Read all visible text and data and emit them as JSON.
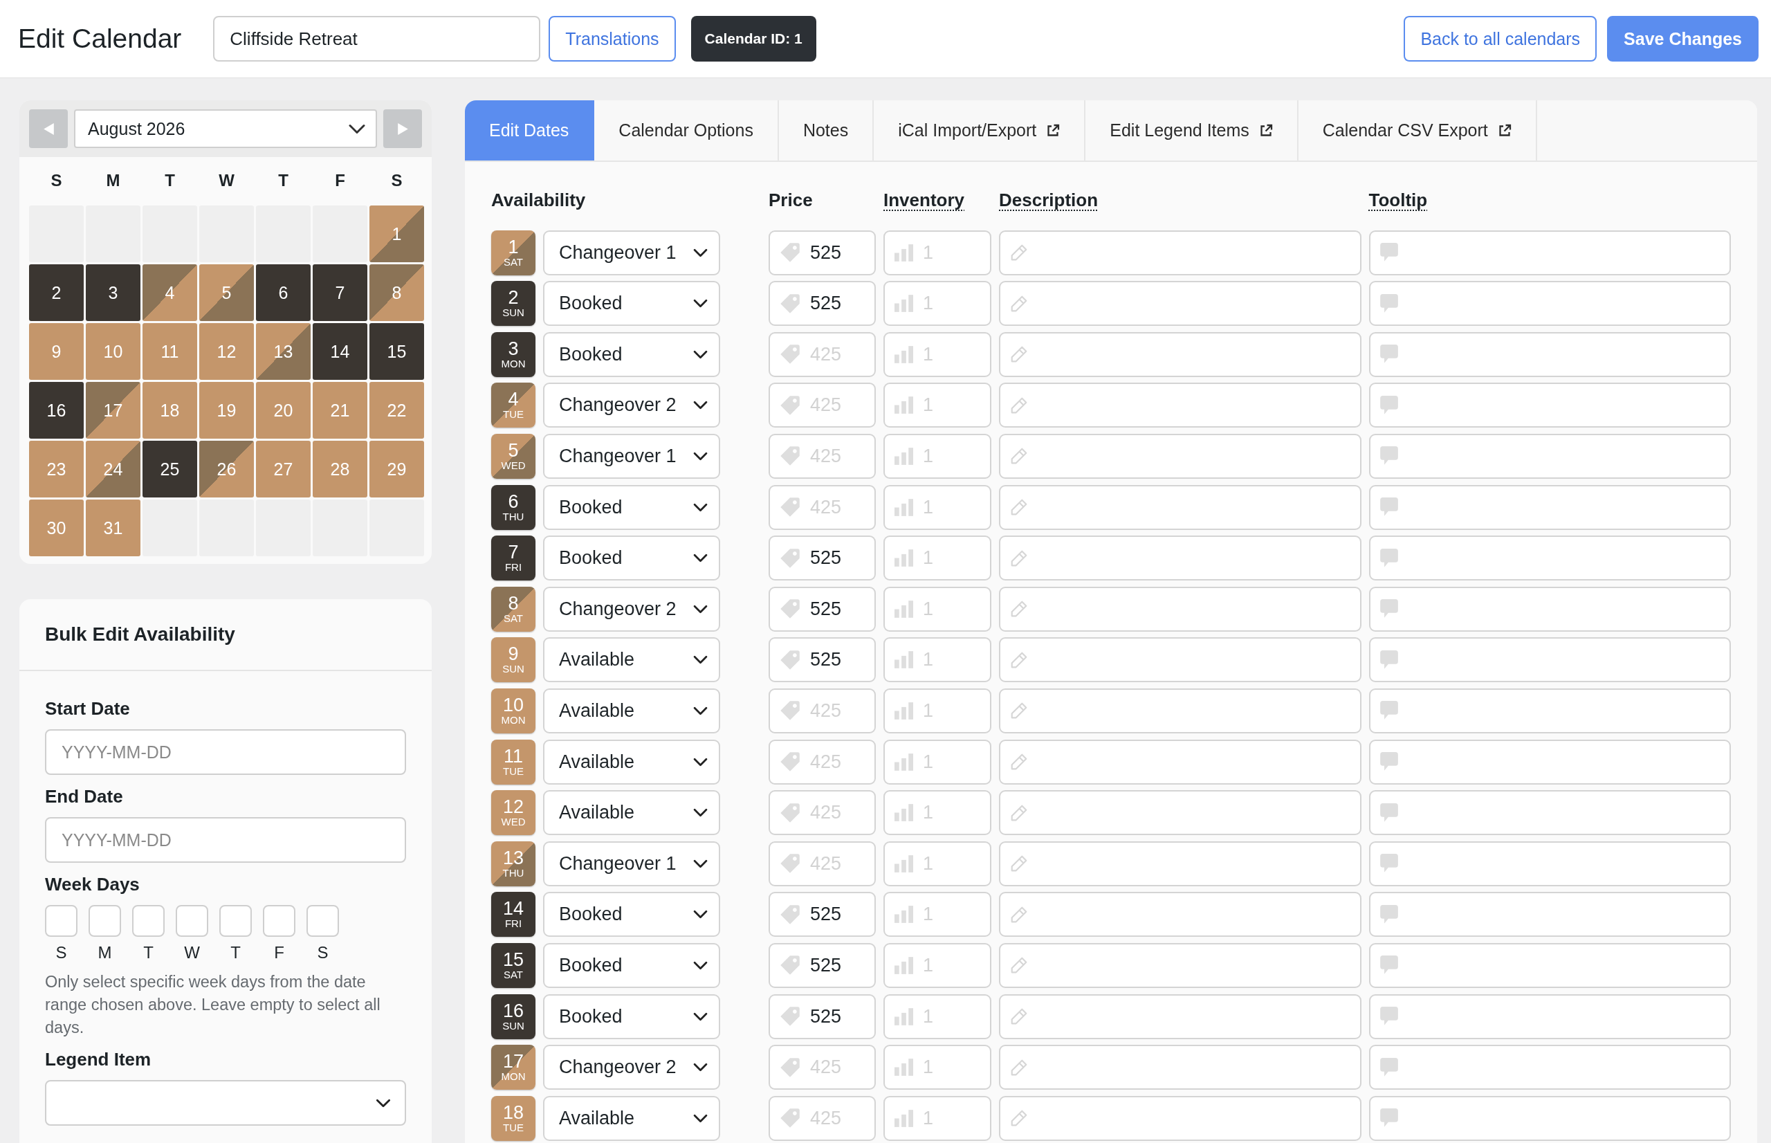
{
  "header": {
    "title": "Edit Calendar",
    "name_field": {
      "value": "Cliffside Retreat"
    },
    "left_buttons": [
      {
        "label": "Translations",
        "kind": "outline"
      },
      {
        "label": "Calendar ID: 1",
        "kind": "dark"
      }
    ],
    "right_buttons": [
      {
        "label": "Back to all calendars",
        "kind": "outline"
      },
      {
        "label": "Save Changes",
        "kind": "primary"
      }
    ]
  },
  "calendar": {
    "month": "August 2026",
    "weekdays": [
      "S",
      "M",
      "T",
      "W",
      "T",
      "F",
      "S"
    ],
    "weeks": [
      [
        {
          "kind": "empty"
        },
        {
          "kind": "empty"
        },
        {
          "kind": "empty"
        },
        {
          "kind": "empty"
        },
        {
          "kind": "empty"
        },
        {
          "kind": "empty"
        },
        {
          "day": "1",
          "kind": "changeover_1"
        }
      ],
      [
        {
          "day": "2",
          "kind": "booked"
        },
        {
          "day": "3",
          "kind": "booked"
        },
        {
          "day": "4",
          "kind": "changeover_2"
        },
        {
          "day": "5",
          "kind": "changeover_1"
        },
        {
          "day": "6",
          "kind": "booked"
        },
        {
          "day": "7",
          "kind": "booked"
        },
        {
          "day": "8",
          "kind": "changeover_2"
        }
      ],
      [
        {
          "day": "9",
          "kind": "available"
        },
        {
          "day": "10",
          "kind": "available"
        },
        {
          "day": "11",
          "kind": "available"
        },
        {
          "day": "12",
          "kind": "available"
        },
        {
          "day": "13",
          "kind": "changeover_1"
        },
        {
          "day": "14",
          "kind": "booked"
        },
        {
          "day": "15",
          "kind": "booked"
        }
      ],
      [
        {
          "day": "16",
          "kind": "booked"
        },
        {
          "day": "17",
          "kind": "changeover_2"
        },
        {
          "day": "18",
          "kind": "available"
        },
        {
          "day": "19",
          "kind": "available"
        },
        {
          "day": "20",
          "kind": "available"
        },
        {
          "day": "21",
          "kind": "available"
        },
        {
          "day": "22",
          "kind": "available"
        }
      ],
      [
        {
          "day": "23",
          "kind": "available"
        },
        {
          "day": "24",
          "kind": "changeover_1"
        },
        {
          "day": "25",
          "kind": "booked"
        },
        {
          "day": "26",
          "kind": "changeover_2"
        },
        {
          "day": "27",
          "kind": "available"
        },
        {
          "day": "28",
          "kind": "available"
        },
        {
          "day": "29",
          "kind": "available"
        }
      ],
      [
        {
          "day": "30",
          "kind": "available"
        },
        {
          "day": "31",
          "kind": "available"
        },
        {
          "kind": "empty"
        },
        {
          "kind": "empty"
        },
        {
          "kind": "empty"
        },
        {
          "kind": "empty"
        },
        {
          "kind": "empty"
        }
      ]
    ]
  },
  "bulk_edit": {
    "title": "Bulk Edit Availability",
    "start_date": {
      "label": "Start Date",
      "placeholder": "YYYY-MM-DD"
    },
    "end_date": {
      "label": "End Date",
      "placeholder": "YYYY-MM-DD"
    },
    "week_days": {
      "label": "Week Days",
      "days": [
        {
          "label": "S",
          "checked": false
        },
        {
          "label": "M",
          "checked": false
        },
        {
          "label": "T",
          "checked": false
        },
        {
          "label": "W",
          "checked": false
        },
        {
          "label": "T",
          "checked": false
        },
        {
          "label": "F",
          "checked": false
        },
        {
          "label": "S",
          "checked": false
        }
      ]
    },
    "help": "Only select specific week days from the date range chosen above. Leave empty to select all days.",
    "legend_item": {
      "label": "Legend Item"
    }
  },
  "tabs": [
    {
      "label": "Edit Dates",
      "selected": true,
      "external": false
    },
    {
      "label": "Calendar Options",
      "selected": false,
      "external": false
    },
    {
      "label": "Notes",
      "selected": false,
      "external": false
    },
    {
      "label": "iCal Import/Export",
      "selected": false,
      "external": true
    },
    {
      "label": "Edit Legend Items",
      "selected": false,
      "external": true
    },
    {
      "label": "Calendar CSV Export",
      "selected": false,
      "external": true
    }
  ],
  "table": {
    "columns": [
      {
        "label": "Availability",
        "hint": false
      },
      {
        "label": "Price",
        "hint": false
      },
      {
        "label": "Inventory",
        "hint": true
      },
      {
        "label": "Description",
        "hint": true
      },
      {
        "label": "Tooltip",
        "hint": true
      }
    ],
    "rows": [
      {
        "day": "1",
        "weekday": "SAT",
        "kind": "changeover_1",
        "availability": "Changeover 1",
        "price": {
          "value": "525"
        },
        "inventory": {
          "placeholder": "1"
        }
      },
      {
        "day": "2",
        "weekday": "SUN",
        "kind": "booked",
        "availability": "Booked",
        "price": {
          "value": "525"
        },
        "inventory": {
          "placeholder": "1"
        }
      },
      {
        "day": "3",
        "weekday": "MON",
        "kind": "booked",
        "availability": "Booked",
        "price": {
          "placeholder": "425"
        },
        "inventory": {
          "placeholder": "1"
        }
      },
      {
        "day": "4",
        "weekday": "TUE",
        "kind": "changeover_2",
        "availability": "Changeover 2",
        "price": {
          "placeholder": "425"
        },
        "inventory": {
          "placeholder": "1"
        }
      },
      {
        "day": "5",
        "weekday": "WED",
        "kind": "changeover_1",
        "availability": "Changeover 1",
        "price": {
          "placeholder": "425"
        },
        "inventory": {
          "placeholder": "1"
        }
      },
      {
        "day": "6",
        "weekday": "THU",
        "kind": "booked",
        "availability": "Booked",
        "price": {
          "placeholder": "425"
        },
        "inventory": {
          "placeholder": "1"
        }
      },
      {
        "day": "7",
        "weekday": "FRI",
        "kind": "booked",
        "availability": "Booked",
        "price": {
          "value": "525"
        },
        "inventory": {
          "placeholder": "1"
        }
      },
      {
        "day": "8",
        "weekday": "SAT",
        "kind": "changeover_2",
        "availability": "Changeover 2",
        "price": {
          "value": "525"
        },
        "inventory": {
          "placeholder": "1"
        }
      },
      {
        "day": "9",
        "weekday": "SUN",
        "kind": "available",
        "availability": "Available",
        "price": {
          "value": "525"
        },
        "inventory": {
          "placeholder": "1"
        }
      },
      {
        "day": "10",
        "weekday": "MON",
        "kind": "available",
        "availability": "Available",
        "price": {
          "placeholder": "425"
        },
        "inventory": {
          "placeholder": "1"
        }
      },
      {
        "day": "11",
        "weekday": "TUE",
        "kind": "available",
        "availability": "Available",
        "price": {
          "placeholder": "425"
        },
        "inventory": {
          "placeholder": "1"
        }
      },
      {
        "day": "12",
        "weekday": "WED",
        "kind": "available",
        "availability": "Available",
        "price": {
          "placeholder": "425"
        },
        "inventory": {
          "placeholder": "1"
        }
      },
      {
        "day": "13",
        "weekday": "THU",
        "kind": "changeover_1",
        "availability": "Changeover 1",
        "price": {
          "placeholder": "425"
        },
        "inventory": {
          "placeholder": "1"
        }
      },
      {
        "day": "14",
        "weekday": "FRI",
        "kind": "booked",
        "availability": "Booked",
        "price": {
          "value": "525"
        },
        "inventory": {
          "placeholder": "1"
        }
      },
      {
        "day": "15",
        "weekday": "SAT",
        "kind": "booked",
        "availability": "Booked",
        "price": {
          "value": "525"
        },
        "inventory": {
          "placeholder": "1"
        }
      },
      {
        "day": "16",
        "weekday": "SUN",
        "kind": "booked",
        "availability": "Booked",
        "price": {
          "value": "525"
        },
        "inventory": {
          "placeholder": "1"
        }
      },
      {
        "day": "17",
        "weekday": "MON",
        "kind": "changeover_2",
        "availability": "Changeover 2",
        "price": {
          "placeholder": "425"
        },
        "inventory": {
          "placeholder": "1"
        }
      },
      {
        "day": "18",
        "weekday": "TUE",
        "kind": "available",
        "availability": "Available",
        "price": {
          "placeholder": "425"
        },
        "inventory": {
          "placeholder": "1"
        }
      }
    ]
  }
}
